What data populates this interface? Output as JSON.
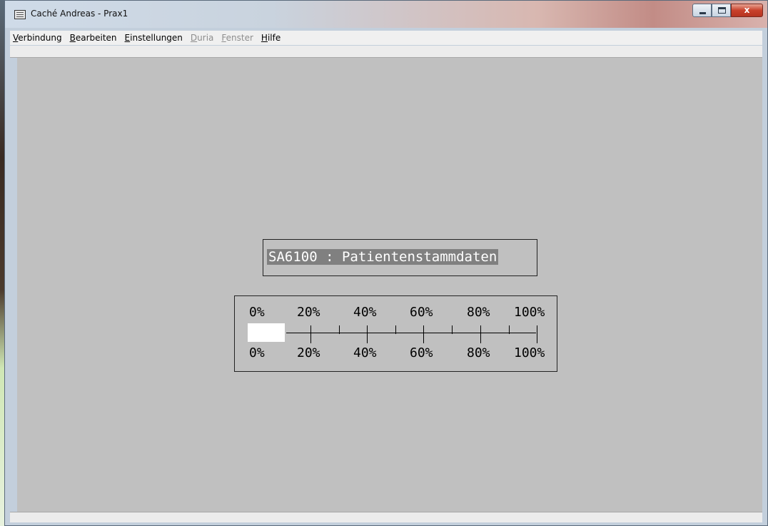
{
  "window": {
    "title": "Caché Andreas - Prax1",
    "close_glyph": "x"
  },
  "menu": [
    {
      "mnemonic": "V",
      "rest": "erbindung",
      "enabled": true
    },
    {
      "mnemonic": "B",
      "rest": "earbeiten",
      "enabled": true
    },
    {
      "mnemonic": "E",
      "rest": "instellungen",
      "enabled": true
    },
    {
      "mnemonic": "D",
      "rest": "uria",
      "enabled": false
    },
    {
      "mnemonic": "F",
      "rest": "enster",
      "enabled": false
    },
    {
      "mnemonic": "H",
      "rest": "ilfe",
      "enabled": true
    }
  ],
  "terminal": {
    "module_title": "SA6100 : Patientenstammdaten",
    "progress": {
      "value_fraction": 0.0,
      "top_labels": [
        "0%",
        "20%",
        "40%",
        "60%",
        "80%",
        "100%"
      ],
      "bottom_labels": [
        "0%",
        "20%",
        "40%",
        "60%",
        "80%",
        "100%"
      ]
    }
  },
  "colors": {
    "terminal_bg": "#c0c0c0",
    "title_highlight": "#808080",
    "close_button": "#c8412b"
  }
}
